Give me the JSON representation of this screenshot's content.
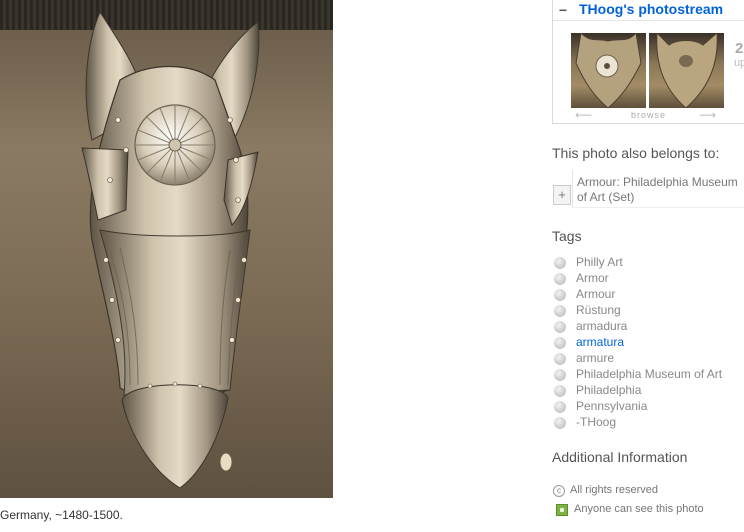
{
  "photo": {
    "caption": "Germany, ~1480-1500."
  },
  "photostream": {
    "title": "THoog's photostream",
    "more_count": "2",
    "more_label": "up",
    "browse_label": "browse"
  },
  "sets": {
    "heading": "This photo also belongs to:",
    "items": [
      {
        "label": "Armour: Philadelphia Museum of Art (Set)"
      }
    ]
  },
  "tags": {
    "heading": "Tags",
    "items": [
      {
        "label": "Philly Art"
      },
      {
        "label": "Armor"
      },
      {
        "label": "Armour"
      },
      {
        "label": "Rüstung"
      },
      {
        "label": "armadura"
      },
      {
        "label": "armatura",
        "active": true
      },
      {
        "label": "armure"
      },
      {
        "label": "Philadelphia Museum of Art"
      },
      {
        "label": "Philadelphia"
      },
      {
        "label": "Pennsylvania"
      },
      {
        "label": "-THoog"
      }
    ]
  },
  "additional": {
    "heading": "Additional Information",
    "rights": "All rights reserved",
    "visibility": "Anyone can see this photo"
  },
  "colors": {
    "link": "#0063dc",
    "visibility_icon": "#7cb342"
  }
}
